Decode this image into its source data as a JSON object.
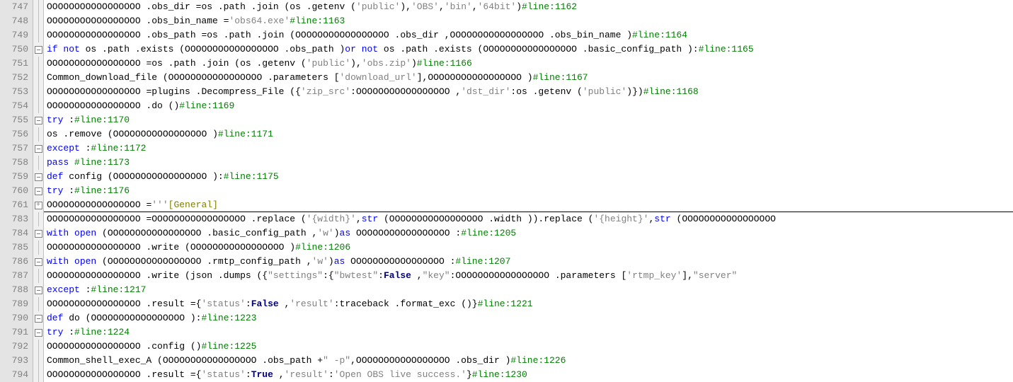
{
  "lines": [
    {
      "n": "747",
      "fold": "line",
      "indent": 5,
      "tokens": [
        {
          "t": "OOOOOOOOOOOOOOOOO .obs_dir ",
          "c": "id"
        },
        {
          "t": "=",
          "c": "op"
        },
        {
          "t": "os ",
          "c": "id"
        },
        {
          "t": ".path .join ",
          "c": "id"
        },
        {
          "t": "(",
          "c": "op"
        },
        {
          "t": "os ",
          "c": "id"
        },
        {
          "t": ".getenv ",
          "c": "id"
        },
        {
          "t": "(",
          "c": "op"
        },
        {
          "t": "'public'",
          "c": "str"
        },
        {
          "t": "),",
          "c": "op"
        },
        {
          "t": "'OBS'",
          "c": "str"
        },
        {
          "t": ",",
          "c": "op"
        },
        {
          "t": "'bin'",
          "c": "str"
        },
        {
          "t": ",",
          "c": "op"
        },
        {
          "t": "'64bit'",
          "c": "str"
        },
        {
          "t": ")",
          "c": "op"
        },
        {
          "t": "#line:1162",
          "c": "cm"
        }
      ]
    },
    {
      "n": "748",
      "fold": "line",
      "indent": 5,
      "tokens": [
        {
          "t": "OOOOOOOOOOOOOOOOO .obs_bin_name ",
          "c": "id"
        },
        {
          "t": "=",
          "c": "op"
        },
        {
          "t": "'obs64.exe'",
          "c": "str"
        },
        {
          "t": "#line:1163",
          "c": "cm"
        }
      ]
    },
    {
      "n": "749",
      "fold": "line",
      "indent": 5,
      "tokens": [
        {
          "t": "OOOOOOOOOOOOOOOOO .obs_path ",
          "c": "id"
        },
        {
          "t": "=",
          "c": "op"
        },
        {
          "t": "os ",
          "c": "id"
        },
        {
          "t": ".path .join ",
          "c": "id"
        },
        {
          "t": "(",
          "c": "op"
        },
        {
          "t": "OOOOOOOOOOOOOOOOO .obs_dir ",
          "c": "id"
        },
        {
          "t": ",",
          "c": "op"
        },
        {
          "t": "OOOOOOOOOOOOOOOOO .obs_bin_name ",
          "c": "id"
        },
        {
          "t": ")",
          "c": "op"
        },
        {
          "t": "#line:1164",
          "c": "cm"
        }
      ]
    },
    {
      "n": "750",
      "fold": "minus",
      "indent": 5,
      "tokens": [
        {
          "t": "if not ",
          "c": "kw"
        },
        {
          "t": "os ",
          "c": "id"
        },
        {
          "t": ".path .exists ",
          "c": "id"
        },
        {
          "t": "(",
          "c": "op"
        },
        {
          "t": "OOOOOOOOOOOOOOOOO .obs_path ",
          "c": "id"
        },
        {
          "t": ")",
          "c": "op"
        },
        {
          "t": "or not ",
          "c": "kw"
        },
        {
          "t": "os ",
          "c": "id"
        },
        {
          "t": ".path .exists ",
          "c": "id"
        },
        {
          "t": "(",
          "c": "op"
        },
        {
          "t": "OOOOOOOOOOOOOOOOO .basic_config_path ",
          "c": "id"
        },
        {
          "t": "):",
          "c": "op"
        },
        {
          "t": "#line:1165",
          "c": "cm"
        }
      ]
    },
    {
      "n": "751",
      "fold": "line",
      "indent": 6,
      "tokens": [
        {
          "t": "OOOOOOOOOOOOOOOOO ",
          "c": "id"
        },
        {
          "t": "=",
          "c": "op"
        },
        {
          "t": "os ",
          "c": "id"
        },
        {
          "t": ".path .join ",
          "c": "id"
        },
        {
          "t": "(",
          "c": "op"
        },
        {
          "t": "os ",
          "c": "id"
        },
        {
          "t": ".getenv ",
          "c": "id"
        },
        {
          "t": "(",
          "c": "op"
        },
        {
          "t": "'public'",
          "c": "str"
        },
        {
          "t": "),",
          "c": "op"
        },
        {
          "t": "'obs.zip'",
          "c": "str"
        },
        {
          "t": ")",
          "c": "op"
        },
        {
          "t": "#line:1166",
          "c": "cm"
        }
      ]
    },
    {
      "n": "752",
      "fold": "line",
      "indent": 6,
      "tokens": [
        {
          "t": "Common_download_file ",
          "c": "id"
        },
        {
          "t": "(",
          "c": "op"
        },
        {
          "t": "OOOOOOOOOOOOOOOOO .parameters ",
          "c": "id"
        },
        {
          "t": "[",
          "c": "op"
        },
        {
          "t": "'download_url'",
          "c": "str"
        },
        {
          "t": "],",
          "c": "op"
        },
        {
          "t": "OOOOOOOOOOOOOOOOO ",
          "c": "id"
        },
        {
          "t": ")",
          "c": "op"
        },
        {
          "t": "#line:1167",
          "c": "cm"
        }
      ]
    },
    {
      "n": "753",
      "fold": "line",
      "indent": 6,
      "tokens": [
        {
          "t": "OOOOOOOOOOOOOOOOO ",
          "c": "id"
        },
        {
          "t": "=",
          "c": "op"
        },
        {
          "t": "plugins .Decompress_File ",
          "c": "id"
        },
        {
          "t": "({",
          "c": "op"
        },
        {
          "t": "'zip_src'",
          "c": "str"
        },
        {
          "t": ":",
          "c": "op"
        },
        {
          "t": "OOOOOOOOOOOOOOOOO ",
          "c": "id"
        },
        {
          "t": ",",
          "c": "op"
        },
        {
          "t": "'dst_dir'",
          "c": "str"
        },
        {
          "t": ":",
          "c": "op"
        },
        {
          "t": "os ",
          "c": "id"
        },
        {
          "t": ".getenv ",
          "c": "id"
        },
        {
          "t": "(",
          "c": "op"
        },
        {
          "t": "'public'",
          "c": "str"
        },
        {
          "t": ")})",
          "c": "op"
        },
        {
          "t": "#line:1168",
          "c": "cm"
        }
      ]
    },
    {
      "n": "754",
      "fold": "line",
      "indent": 6,
      "tokens": [
        {
          "t": "OOOOOOOOOOOOOOOOO .do ",
          "c": "id"
        },
        {
          "t": "()",
          "c": "op"
        },
        {
          "t": "#line:1169",
          "c": "cm"
        }
      ]
    },
    {
      "n": "755",
      "fold": "minus",
      "indent": 6,
      "tokens": [
        {
          "t": "try ",
          "c": "kw"
        },
        {
          "t": ":",
          "c": "op"
        },
        {
          "t": "#line:1170",
          "c": "cm"
        }
      ]
    },
    {
      "n": "756",
      "fold": "line",
      "indent": 7,
      "tokens": [
        {
          "t": "os ",
          "c": "id"
        },
        {
          "t": ".remove ",
          "c": "id"
        },
        {
          "t": "(",
          "c": "op"
        },
        {
          "t": "OOOOOOOOOOOOOOOOO ",
          "c": "id"
        },
        {
          "t": ")",
          "c": "op"
        },
        {
          "t": "#line:1171",
          "c": "cm"
        }
      ]
    },
    {
      "n": "757",
      "fold": "minus",
      "indent": 6,
      "tokens": [
        {
          "t": "except ",
          "c": "kw"
        },
        {
          "t": ":",
          "c": "op"
        },
        {
          "t": "#line:1172",
          "c": "cm"
        }
      ]
    },
    {
      "n": "758",
      "fold": "line",
      "indent": 7,
      "tokens": [
        {
          "t": "pass ",
          "c": "kw"
        },
        {
          "t": "#line:1173",
          "c": "cm"
        }
      ]
    },
    {
      "n": "759",
      "fold": "minus",
      "indent": 4,
      "tokens": [
        {
          "t": "def ",
          "c": "kw"
        },
        {
          "t": "config ",
          "c": "defname"
        },
        {
          "t": "(",
          "c": "op"
        },
        {
          "t": "OOOOOOOOOOOOOOOOO ",
          "c": "id"
        },
        {
          "t": "):",
          "c": "op"
        },
        {
          "t": "#line:1175",
          "c": "cm"
        }
      ]
    },
    {
      "n": "760",
      "fold": "minus",
      "indent": 5,
      "tokens": [
        {
          "t": "try ",
          "c": "kw"
        },
        {
          "t": ":",
          "c": "op"
        },
        {
          "t": "#line:1176",
          "c": "cm"
        }
      ]
    },
    {
      "n": "761",
      "fold": "plus",
      "indent": 6,
      "divider": true,
      "tokens": [
        {
          "t": "OOOOOOOOOOOOOOOOO ",
          "c": "id"
        },
        {
          "t": "=",
          "c": "op"
        },
        {
          "t": "'''",
          "c": "str"
        },
        {
          "t": "[General]",
          "c": "gen"
        }
      ]
    },
    {
      "n": "783",
      "fold": "line",
      "indent": 6,
      "tokens": [
        {
          "t": "OOOOOOOOOOOOOOOOO ",
          "c": "id"
        },
        {
          "t": "=",
          "c": "op"
        },
        {
          "t": "OOOOOOOOOOOOOOOOO .replace ",
          "c": "id"
        },
        {
          "t": "(",
          "c": "op"
        },
        {
          "t": "'{width}'",
          "c": "str"
        },
        {
          "t": ",",
          "c": "op"
        },
        {
          "t": "str ",
          "c": "kw"
        },
        {
          "t": "(",
          "c": "op"
        },
        {
          "t": "OOOOOOOOOOOOOOOOO .width ",
          "c": "id"
        },
        {
          "t": ")).replace ",
          "c": "id"
        },
        {
          "t": "(",
          "c": "op"
        },
        {
          "t": "'{height}'",
          "c": "str"
        },
        {
          "t": ",",
          "c": "op"
        },
        {
          "t": "str ",
          "c": "kw"
        },
        {
          "t": "(",
          "c": "op"
        },
        {
          "t": "OOOOOOOOOOOOOOOOO",
          "c": "id"
        }
      ]
    },
    {
      "n": "784",
      "fold": "minus",
      "indent": 6,
      "tokens": [
        {
          "t": "with ",
          "c": "kw"
        },
        {
          "t": "open ",
          "c": "kw"
        },
        {
          "t": "(",
          "c": "op"
        },
        {
          "t": "OOOOOOOOOOOOOOOOO .basic_config_path ",
          "c": "id"
        },
        {
          "t": ",",
          "c": "op"
        },
        {
          "t": "'w'",
          "c": "str"
        },
        {
          "t": ")",
          "c": "op"
        },
        {
          "t": "as ",
          "c": "kw"
        },
        {
          "t": "OOOOOOOOOOOOOOOOO ",
          "c": "id"
        },
        {
          "t": ":",
          "c": "op"
        },
        {
          "t": "#line:1205",
          "c": "cm"
        }
      ]
    },
    {
      "n": "785",
      "fold": "line",
      "indent": 7,
      "tokens": [
        {
          "t": "OOOOOOOOOOOOOOOOO .write ",
          "c": "id"
        },
        {
          "t": "(",
          "c": "op"
        },
        {
          "t": "OOOOOOOOOOOOOOOOO ",
          "c": "id"
        },
        {
          "t": ")",
          "c": "op"
        },
        {
          "t": "#line:1206",
          "c": "cm"
        }
      ]
    },
    {
      "n": "786",
      "fold": "minus",
      "indent": 6,
      "tokens": [
        {
          "t": "with ",
          "c": "kw"
        },
        {
          "t": "open ",
          "c": "kw"
        },
        {
          "t": "(",
          "c": "op"
        },
        {
          "t": "OOOOOOOOOOOOOOOOO .rmtp_config_path ",
          "c": "id"
        },
        {
          "t": ",",
          "c": "op"
        },
        {
          "t": "'w'",
          "c": "str"
        },
        {
          "t": ")",
          "c": "op"
        },
        {
          "t": "as ",
          "c": "kw"
        },
        {
          "t": "OOOOOOOOOOOOOOOOO ",
          "c": "id"
        },
        {
          "t": ":",
          "c": "op"
        },
        {
          "t": "#line:1207",
          "c": "cm"
        }
      ]
    },
    {
      "n": "787",
      "fold": "line",
      "indent": 7,
      "tokens": [
        {
          "t": "OOOOOOOOOOOOOOOOO .write ",
          "c": "id"
        },
        {
          "t": "(",
          "c": "op"
        },
        {
          "t": "json .dumps ",
          "c": "id"
        },
        {
          "t": "({",
          "c": "op"
        },
        {
          "t": "\"settings\"",
          "c": "str"
        },
        {
          "t": ":{",
          "c": "op"
        },
        {
          "t": "\"bwtest\"",
          "c": "str"
        },
        {
          "t": ":",
          "c": "op"
        },
        {
          "t": "False ",
          "c": "bool"
        },
        {
          "t": ",",
          "c": "op"
        },
        {
          "t": "\"key\"",
          "c": "str"
        },
        {
          "t": ":",
          "c": "op"
        },
        {
          "t": "OOOOOOOOOOOOOOOOO .parameters ",
          "c": "id"
        },
        {
          "t": "[",
          "c": "op"
        },
        {
          "t": "'rtmp_key'",
          "c": "str"
        },
        {
          "t": "],",
          "c": "op"
        },
        {
          "t": "\"server\"",
          "c": "str"
        }
      ]
    },
    {
      "n": "788",
      "fold": "minus",
      "indent": 5,
      "tokens": [
        {
          "t": "except ",
          "c": "kw"
        },
        {
          "t": ":",
          "c": "op"
        },
        {
          "t": "#line:1217",
          "c": "cm"
        }
      ]
    },
    {
      "n": "789",
      "fold": "line",
      "indent": 6,
      "tokens": [
        {
          "t": "OOOOOOOOOOOOOOOOO .result ",
          "c": "id"
        },
        {
          "t": "={",
          "c": "op"
        },
        {
          "t": "'status'",
          "c": "str"
        },
        {
          "t": ":",
          "c": "op"
        },
        {
          "t": "False ",
          "c": "bool"
        },
        {
          "t": ",",
          "c": "op"
        },
        {
          "t": "'result'",
          "c": "str"
        },
        {
          "t": ":",
          "c": "op"
        },
        {
          "t": "traceback .format_exc ",
          "c": "id"
        },
        {
          "t": "()}",
          "c": "op"
        },
        {
          "t": "#line:1221",
          "c": "cm"
        }
      ]
    },
    {
      "n": "790",
      "fold": "minus",
      "indent": 4,
      "tokens": [
        {
          "t": "def ",
          "c": "kw"
        },
        {
          "t": "do ",
          "c": "defname"
        },
        {
          "t": "(",
          "c": "op"
        },
        {
          "t": "OOOOOOOOOOOOOOOOO ",
          "c": "id"
        },
        {
          "t": "):",
          "c": "op"
        },
        {
          "t": "#line:1223",
          "c": "cm"
        }
      ]
    },
    {
      "n": "791",
      "fold": "minus",
      "indent": 5,
      "tokens": [
        {
          "t": "try ",
          "c": "kw"
        },
        {
          "t": ":",
          "c": "op"
        },
        {
          "t": "#line:1224",
          "c": "cm"
        }
      ]
    },
    {
      "n": "792",
      "fold": "line",
      "indent": 6,
      "tokens": [
        {
          "t": "OOOOOOOOOOOOOOOOO .config ",
          "c": "id"
        },
        {
          "t": "()",
          "c": "op"
        },
        {
          "t": "#line:1225",
          "c": "cm"
        }
      ]
    },
    {
      "n": "793",
      "fold": "line",
      "indent": 6,
      "tokens": [
        {
          "t": "Common_shell_exec_A ",
          "c": "id"
        },
        {
          "t": "(",
          "c": "op"
        },
        {
          "t": "OOOOOOOOOOOOOOOOO .obs_path ",
          "c": "id"
        },
        {
          "t": "+",
          "c": "op"
        },
        {
          "t": "\" -p\"",
          "c": "str"
        },
        {
          "t": ",",
          "c": "op"
        },
        {
          "t": "OOOOOOOOOOOOOOOOO .obs_dir ",
          "c": "id"
        },
        {
          "t": ")",
          "c": "op"
        },
        {
          "t": "#line:1226",
          "c": "cm"
        }
      ]
    },
    {
      "n": "794",
      "fold": "line",
      "indent": 6,
      "tokens": [
        {
          "t": "OOOOOOOOOOOOOOOOO .result ",
          "c": "id"
        },
        {
          "t": "={",
          "c": "op"
        },
        {
          "t": "'status'",
          "c": "str"
        },
        {
          "t": ":",
          "c": "op"
        },
        {
          "t": "True ",
          "c": "bool"
        },
        {
          "t": ",",
          "c": "op"
        },
        {
          "t": "'result'",
          "c": "str"
        },
        {
          "t": ":",
          "c": "op"
        },
        {
          "t": "'Open OBS live success.'",
          "c": "str"
        },
        {
          "t": "}",
          "c": "op"
        },
        {
          "t": "#line:1230",
          "c": "cm"
        }
      ]
    }
  ]
}
